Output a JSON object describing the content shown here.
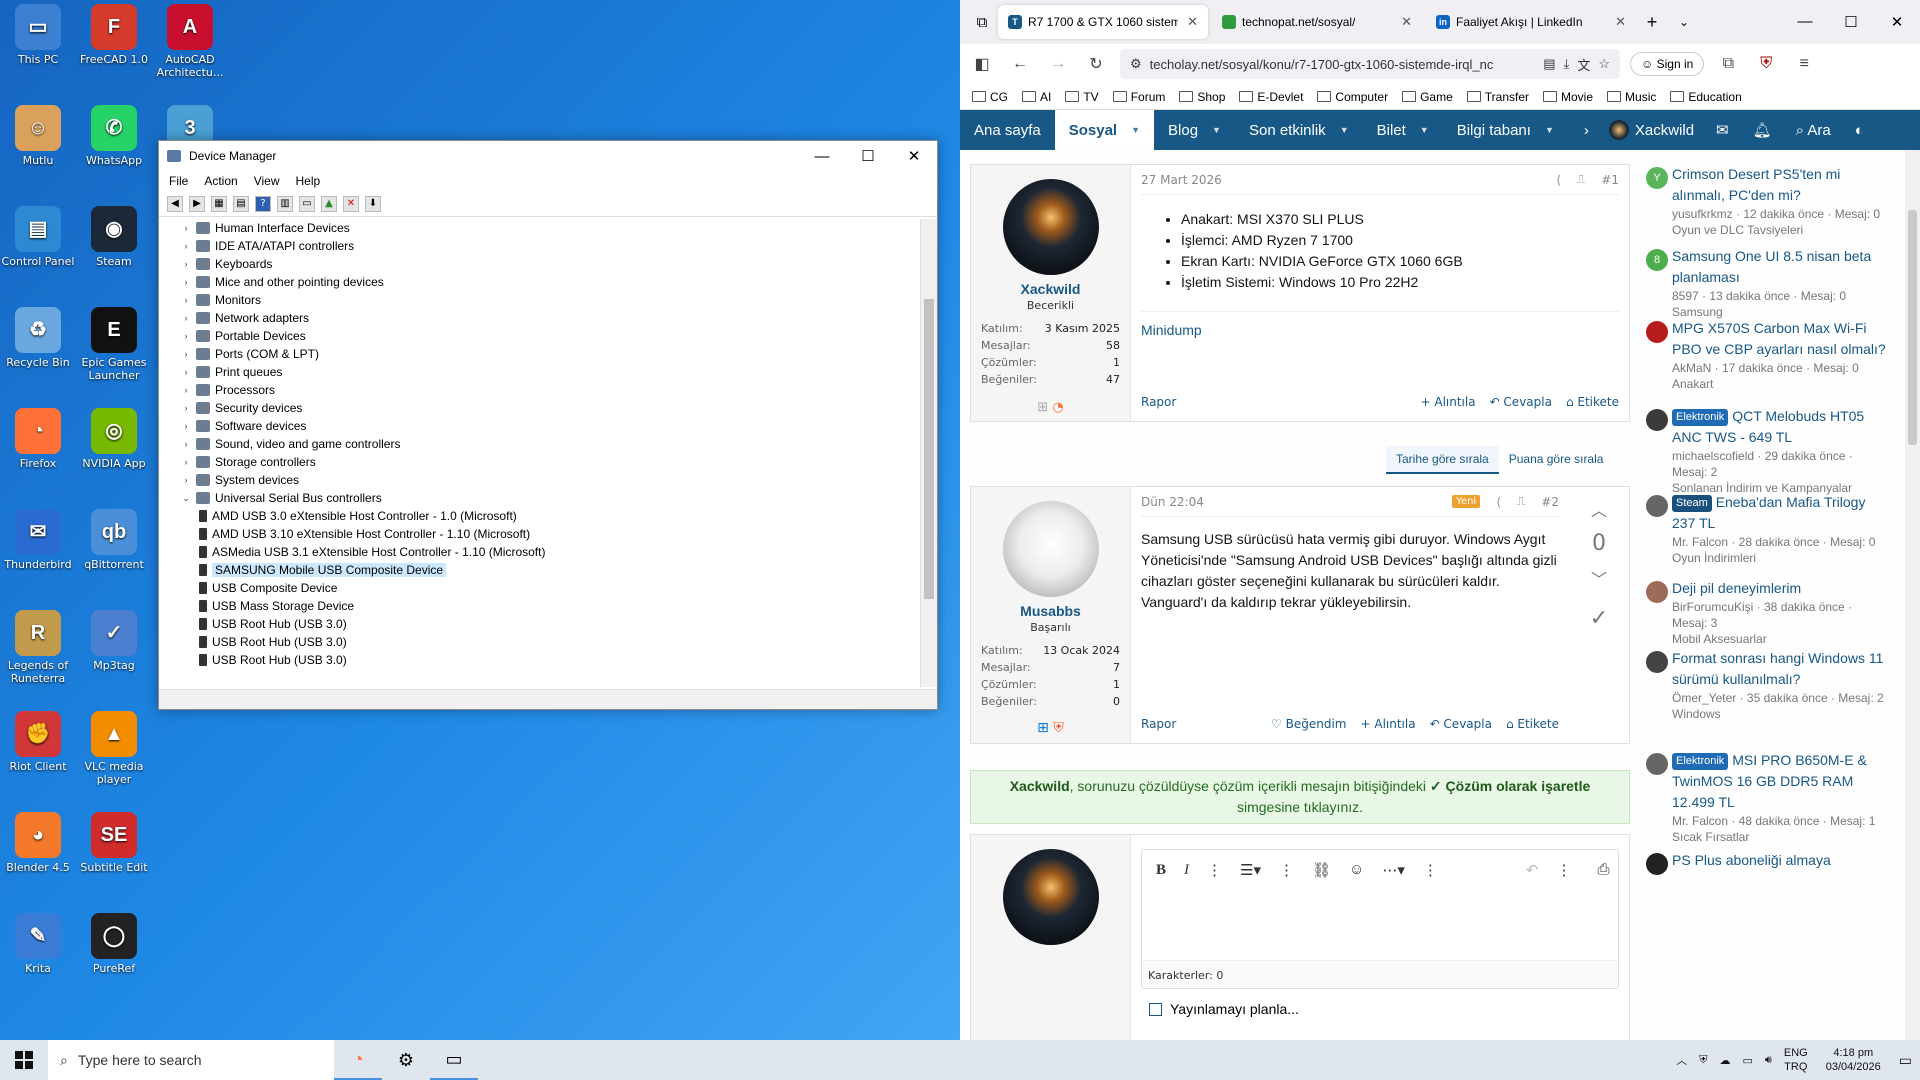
{
  "desktop": {
    "icons": [
      {
        "label": "This PC",
        "color": "#3d7fd0",
        "glyph": "▭"
      },
      {
        "label": "FreeCAD 1.0",
        "color": "#d63a2a",
        "glyph": "F"
      },
      {
        "label": "AutoCAD Architectu...",
        "color": "#c8102e",
        "glyph": "A"
      },
      {
        "label": "Mutlu",
        "color": "#d9a15b",
        "glyph": "☺"
      },
      {
        "label": "WhatsApp",
        "color": "#25d366",
        "glyph": "✆"
      },
      {
        "label": "",
        "color": "#4aa0d5",
        "glyph": "3"
      },
      {
        "label": "Control Panel",
        "color": "#2d89d1",
        "glyph": "▤"
      },
      {
        "label": "Steam",
        "color": "#1b2838",
        "glyph": "◉"
      },
      {
        "label": "Recycle Bin",
        "color": "#6aa9e0",
        "glyph": "♻"
      },
      {
        "label": "Epic Games Launcher",
        "color": "#111111",
        "glyph": "E"
      },
      {
        "label": "Firefox",
        "color": "#ff7139",
        "glyph": "◔"
      },
      {
        "label": "NVIDIA App",
        "color": "#76b900",
        "glyph": "◎"
      },
      {
        "label": "Thunderbird",
        "color": "#2a6bd1",
        "glyph": "✉"
      },
      {
        "label": "qBittorrent",
        "color": "#4a8fd8",
        "glyph": "qb"
      },
      {
        "label": "Legends of Runeterra",
        "color": "#c29a4b",
        "glyph": "R"
      },
      {
        "label": "Mp3tag",
        "color": "#4b7fd0",
        "glyph": "✓"
      },
      {
        "label": "Riot Client",
        "color": "#d13639",
        "glyph": "✊"
      },
      {
        "label": "VLC media player",
        "color": "#f28d00",
        "glyph": "▲"
      },
      {
        "label": "Blender 4.5",
        "color": "#f5792a",
        "glyph": "◕"
      },
      {
        "label": "Subtitle Edit",
        "color": "#d12c2c",
        "glyph": "SE"
      },
      {
        "label": "Krita",
        "color": "#3a7bd5",
        "glyph": "✎"
      },
      {
        "label": "PureRef",
        "color": "#222222",
        "glyph": "◯"
      }
    ]
  },
  "device_manager": {
    "title": "Device Manager",
    "menu": [
      "File",
      "Action",
      "View",
      "Help"
    ],
    "tree": [
      {
        "label": "Human Interface Devices",
        "expanded": false
      },
      {
        "label": "IDE ATA/ATAPI controllers",
        "expanded": false
      },
      {
        "label": "Keyboards",
        "expanded": false
      },
      {
        "label": "Mice and other pointing devices",
        "expanded": false
      },
      {
        "label": "Monitors",
        "expanded": false
      },
      {
        "label": "Network adapters",
        "expanded": false
      },
      {
        "label": "Portable Devices",
        "expanded": false
      },
      {
        "label": "Ports (COM & LPT)",
        "expanded": false
      },
      {
        "label": "Print queues",
        "expanded": false
      },
      {
        "label": "Processors",
        "expanded": false
      },
      {
        "label": "Security devices",
        "expanded": false
      },
      {
        "label": "Software devices",
        "expanded": false
      },
      {
        "label": "Sound, video and game controllers",
        "expanded": false
      },
      {
        "label": "Storage controllers",
        "expanded": false
      },
      {
        "label": "System devices",
        "expanded": false
      },
      {
        "label": "Universal Serial Bus controllers",
        "expanded": true
      }
    ],
    "usb_children": [
      "AMD USB 3.0 eXtensible Host Controller - 1.0 (Microsoft)",
      "AMD USB 3.10 eXtensible Host Controller - 1.10 (Microsoft)",
      "ASMedia USB 3.1 eXtensible Host Controller - 1.10 (Microsoft)",
      "SAMSUNG Mobile USB Composite Device",
      "USB Composite Device",
      "USB Mass Storage Device",
      "USB Root Hub (USB 3.0)",
      "USB Root Hub (USB 3.0)",
      "USB Root Hub (USB 3.0)"
    ],
    "selected": "SAMSUNG Mobile USB Composite Device"
  },
  "browser": {
    "tabs": [
      {
        "label": "R7 1700 & GTX 1060 sistem",
        "fav": "T",
        "favcolor": "#185886",
        "active": true
      },
      {
        "label": "technopat.net/sosyal/",
        "fav": "",
        "favcolor": "#2e9b3e",
        "active": false
      },
      {
        "label": "Faaliyet Akışı | LinkedIn",
        "fav": "in",
        "favcolor": "#0a66c2",
        "active": false
      }
    ],
    "url": "techolay.net/sosyal/konu/r7-1700-gtx-1060-sistemde-irql_nc",
    "signin": "Sign in",
    "bookmarks": [
      "CG",
      "AI",
      "TV",
      "Forum",
      "Shop",
      "E-Devlet",
      "Computer",
      "Game",
      "Transfer",
      "Movie",
      "Music",
      "Education"
    ]
  },
  "site": {
    "nav": [
      {
        "label": "Ana sayfa",
        "active": false,
        "dd": false
      },
      {
        "label": "Sosyal",
        "active": true,
        "dd": true
      },
      {
        "label": "Blog",
        "active": false,
        "dd": true
      },
      {
        "label": "Son etkinlik",
        "active": false,
        "dd": true
      },
      {
        "label": "Bilet",
        "active": false,
        "dd": true
      },
      {
        "label": "Bilgi tabanı",
        "active": false,
        "dd": true
      }
    ],
    "user": "Xackwild",
    "search": "Ara"
  },
  "posts": [
    {
      "user": "Xackwild",
      "role": "Becerikli",
      "date": "27 Mart 2026",
      "num": "#1",
      "stats": [
        [
          "Katılım:",
          "3 Kasım 2025"
        ],
        [
          "Mesajlar:",
          "58"
        ],
        [
          "Çözümler:",
          "1"
        ],
        [
          "Beğeniler:",
          "47"
        ]
      ],
      "specs": [
        "Anakart: MSI X370 SLI PLUS",
        "İşlemci: AMD Ryzen 7 1700",
        "Ekran Kartı: NVIDIA GeForce GTX 1060 6GB",
        "İşletim Sistemi: Windows 10 Pro 22H2"
      ],
      "link": "Minidump",
      "report": "Rapor",
      "actions": [
        "+ Alıntıla",
        "↶ Cevapla",
        "⌂ Etikete"
      ]
    },
    {
      "user": "Musabbs",
      "role": "Başarılı",
      "date": "Dün 22:04",
      "num": "#2",
      "badge": "Yeni",
      "stats": [
        [
          "Katılım:",
          "13 Ocak 2024"
        ],
        [
          "Mesajlar:",
          "7"
        ],
        [
          "Çözümler:",
          "1"
        ],
        [
          "Beğeniler:",
          "0"
        ]
      ],
      "text": "Samsung USB sürücüsü hata vermiş gibi duruyor. Windows Aygıt Yöneticisi'nde \"Samsung Android USB Devices\" başlığı altında gizli cihazları göster seçeneğini kullanarak bu sürücüleri kaldır.",
      "text2": "Vanguard'ı da kaldırıp tekrar yükleyebilirsin.",
      "score": "0",
      "report": "Rapor",
      "actions": [
        "♡ Beğendim",
        "+ Alıntıla",
        "↶ Cevapla",
        "⌂ Etikete"
      ]
    }
  ],
  "sorting": [
    "Tarihe göre sırala",
    "Puana göre sırala"
  ],
  "tip": {
    "user": "Xackwild",
    "text1": ", sorunuzu çözüldüyse çözüm içerikli mesajın bitişiğindeki ",
    "bold": "✓ Çözüm olarak işaretle",
    "text2": "simgesine tıklayınız."
  },
  "editor": {
    "chars": "Karakterler: 0",
    "schedule": "Yayınlamayı planla..."
  },
  "sidebar": [
    {
      "title": "Crimson Desert PS5'ten mi alınmalı, PC'den mi?",
      "meta": "yusufkrkmz · 12 dakika önce · Mesaj: 0",
      "forum": "Oyun ve DLC Tavsiyeleri",
      "av": "#5bb55b",
      "letter": "Y",
      "badge": ""
    },
    {
      "title": "Samsung One UI 8.5 nisan beta planlaması",
      "meta": "8597 · 13 dakika önce · Mesaj: 0",
      "forum": "Samsung",
      "av": "#4cae4c",
      "letter": "8",
      "badge": ""
    },
    {
      "title": "MPG X570S Carbon Max Wi-Fi PBO ve CBP ayarları nasıl olmalı?",
      "meta": "AkMaN · 17 dakika önce · Mesaj: 0",
      "forum": "Anakart",
      "av": "#b71c1c",
      "letter": "",
      "badge": ""
    },
    {
      "title": "QCT Melobuds HT05 ANC TWS - 649 TL",
      "meta": "michaelscofield · 29 dakika önce · Mesaj: 2",
      "forum": "Sonlanan İndirim ve Kampanyalar",
      "av": "#3b3b3b",
      "letter": "",
      "badge": "Elektronik",
      "bcolor": "#1f6bb5"
    },
    {
      "title": "Eneba'dan Mafia Trilogy 237 TL",
      "meta": "Mr. Falcon · 28 dakika önce · Mesaj: 0",
      "forum": "Oyun İndirimleri",
      "av": "#666666",
      "letter": "",
      "badge": "Steam",
      "bcolor": "#1b4f7d"
    },
    {
      "title": "Deji pil deneyimlerim",
      "meta": "BirForumcuKişi · 38 dakika önce · Mesaj: 3",
      "forum": "Mobil Aksesuarlar",
      "av": "#9c6b5a",
      "letter": "",
      "badge": ""
    },
    {
      "title": "Format sonrası hangi Windows 11 sürümü kullanılmalı?",
      "meta": "Ömer_Yeter · 35 dakika önce · Mesaj: 2",
      "forum": "Windows",
      "av": "#444444",
      "letter": "",
      "badge": ""
    },
    {
      "title": "MSI PRO B650M-E & TwinMOS 16 GB DDR5 RAM 12.499 TL",
      "meta": "Mr. Falcon · 48 dakika önce · Mesaj: 1",
      "forum": "Sıcak Fırsatlar",
      "av": "#666666",
      "letter": "",
      "badge": "Elektronik",
      "bcolor": "#1f6bb5"
    },
    {
      "title": "PS Plus aboneliği almaya",
      "meta": "",
      "forum": "",
      "av": "#222222",
      "letter": "",
      "badge": ""
    }
  ],
  "taskbar": {
    "search": "Type here to search",
    "lang": "ENG",
    "layout": "TRQ",
    "time": "4:18 pm",
    "date": "03/04/2026"
  }
}
